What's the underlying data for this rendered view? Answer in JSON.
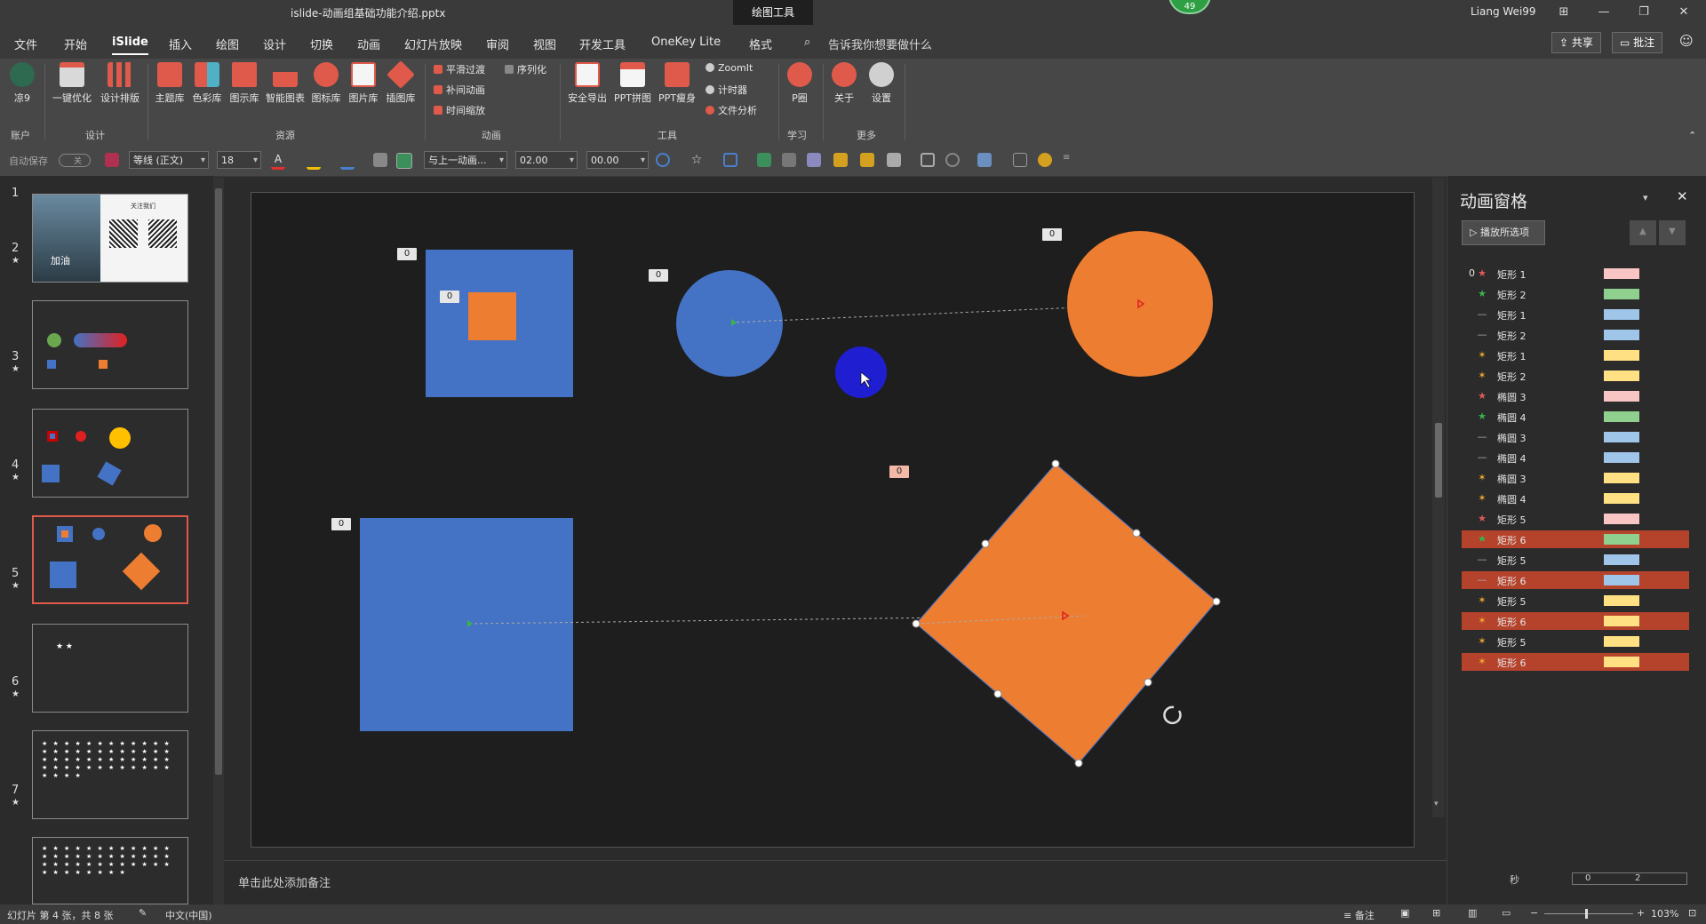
{
  "window": {
    "file_title": "islide-动画组基础功能介绍.pptx",
    "context_tab": "绘图工具",
    "badge": "49",
    "user": "Liang Wei99"
  },
  "menu": {
    "items": [
      "文件",
      "开始",
      "iSlide",
      "插入",
      "绘图",
      "设计",
      "切换",
      "动画",
      "幻灯片放映",
      "审阅",
      "视图",
      "开发工具",
      "OneKey Lite",
      "格式"
    ],
    "active": "iSlide",
    "tell_me": "告诉我你想要做什么",
    "share": "共享",
    "comment": "批注"
  },
  "ribbon": {
    "account": {
      "label": "凉9",
      "group": "账户"
    },
    "design": {
      "items": [
        "一键优化",
        "设计排版"
      ],
      "group": "设计"
    },
    "resources": {
      "items": [
        "主题库",
        "色彩库",
        "图示库",
        "智能图表",
        "图标库",
        "图片库",
        "插图库"
      ],
      "group": "资源"
    },
    "animation": {
      "items": [
        "平滑过渡",
        "补间动画",
        "时间缩放",
        "序列化"
      ],
      "group": "动画"
    },
    "tools": {
      "items": [
        "安全导出",
        "PPT拼图",
        "PPT瘦身",
        "ZoomIt",
        "计时器",
        "文件分析"
      ],
      "group": "工具"
    },
    "learn": {
      "items": [
        "P圈"
      ],
      "group": "学习"
    },
    "more": {
      "items": [
        "关于",
        "设置"
      ],
      "group": "更多"
    }
  },
  "qat": {
    "autosave": "自动保存",
    "autosave_state": "关",
    "font": "等线 (正文)",
    "size": "18",
    "trigger": "与上一动画...",
    "duration": "02.00",
    "delay": "00.00"
  },
  "thumbnails": [
    {
      "num": "1",
      "star": false,
      "caption": "加油",
      "label": "关注我们"
    },
    {
      "num": "2",
      "star": true
    },
    {
      "num": "3",
      "star": true
    },
    {
      "num": "4",
      "star": true,
      "selected": true
    },
    {
      "num": "5",
      "star": true
    },
    {
      "num": "6",
      "star": true
    },
    {
      "num": "7",
      "star": true
    }
  ],
  "slide": {
    "tags": [
      "0",
      "0",
      "0",
      "0",
      "0",
      "0"
    ],
    "colors": {
      "blue": "#4472c4",
      "orange": "#ed7d31",
      "cursor_dot": "#1f1fd1"
    }
  },
  "notes_placeholder": "单击此处添加备注",
  "anim_pane": {
    "title": "动画窗格",
    "play_button": "播放所选项",
    "rows": [
      {
        "num": "0",
        "icon": "★",
        "icon_color": "#e05a5a",
        "name": "矩形 1",
        "bar": "#f8c4c4",
        "hl": false
      },
      {
        "num": "",
        "icon": "★",
        "icon_color": "#39b54a",
        "name": "矩形 2",
        "bar": "#8fd08f",
        "hl": false
      },
      {
        "num": "",
        "icon": "—",
        "icon_color": "#aaaaaa",
        "name": "矩形 1",
        "bar": "#9fc5e8",
        "hl": false
      },
      {
        "num": "",
        "icon": "—",
        "icon_color": "#aaaaaa",
        "name": "矩形 2",
        "bar": "#9fc5e8",
        "hl": false
      },
      {
        "num": "",
        "icon": "✶",
        "icon_color": "#f0a830",
        "name": "矩形 1",
        "bar": "#ffe082",
        "hl": false
      },
      {
        "num": "",
        "icon": "✶",
        "icon_color": "#f0a830",
        "name": "矩形 2",
        "bar": "#ffe082",
        "hl": false
      },
      {
        "num": "",
        "icon": "★",
        "icon_color": "#e05a5a",
        "name": "椭圆 3",
        "bar": "#f8c4c4",
        "hl": false
      },
      {
        "num": "",
        "icon": "★",
        "icon_color": "#39b54a",
        "name": "椭圆 4",
        "bar": "#8fd08f",
        "hl": false
      },
      {
        "num": "",
        "icon": "—",
        "icon_color": "#aaaaaa",
        "name": "椭圆 3",
        "bar": "#9fc5e8",
        "hl": false
      },
      {
        "num": "",
        "icon": "—",
        "icon_color": "#aaaaaa",
        "name": "椭圆 4",
        "bar": "#9fc5e8",
        "hl": false
      },
      {
        "num": "",
        "icon": "✶",
        "icon_color": "#f0a830",
        "name": "椭圆 3",
        "bar": "#ffe082",
        "hl": false
      },
      {
        "num": "",
        "icon": "✶",
        "icon_color": "#f0a830",
        "name": "椭圆 4",
        "bar": "#ffe082",
        "hl": false
      },
      {
        "num": "",
        "icon": "★",
        "icon_color": "#e05a5a",
        "name": "矩形 5",
        "bar": "#f8c4c4",
        "hl": false
      },
      {
        "num": "",
        "icon": "★",
        "icon_color": "#39b54a",
        "name": "矩形 6",
        "bar": "#8fd08f",
        "hl": true
      },
      {
        "num": "",
        "icon": "—",
        "icon_color": "#aaaaaa",
        "name": "矩形 5",
        "bar": "#9fc5e8",
        "hl": false
      },
      {
        "num": "",
        "icon": "—",
        "icon_color": "#aaaaaa",
        "name": "矩形 6",
        "bar": "#9fc5e8",
        "hl": true
      },
      {
        "num": "",
        "icon": "✶",
        "icon_color": "#f0a830",
        "name": "矩形 5",
        "bar": "#ffe082",
        "hl": false
      },
      {
        "num": "",
        "icon": "✶",
        "icon_color": "#f0a830",
        "name": "矩形 6",
        "bar": "#ffe082",
        "hl": true
      },
      {
        "num": "",
        "icon": "✶",
        "icon_color": "#f0a830",
        "name": "矩形 5",
        "bar": "#ffe082",
        "hl": false
      },
      {
        "num": "",
        "icon": "✶",
        "icon_color": "#f0a830",
        "name": "矩形 6",
        "bar": "#ffe082",
        "hl": true
      }
    ],
    "timeline_unit": "秒",
    "timeline_ticks": [
      "0",
      "2"
    ]
  },
  "status": {
    "slide_info": "幻灯片 第 4 张，共 8 张",
    "language": "中文(中国)",
    "notes": "备注",
    "zoom": "103%"
  }
}
